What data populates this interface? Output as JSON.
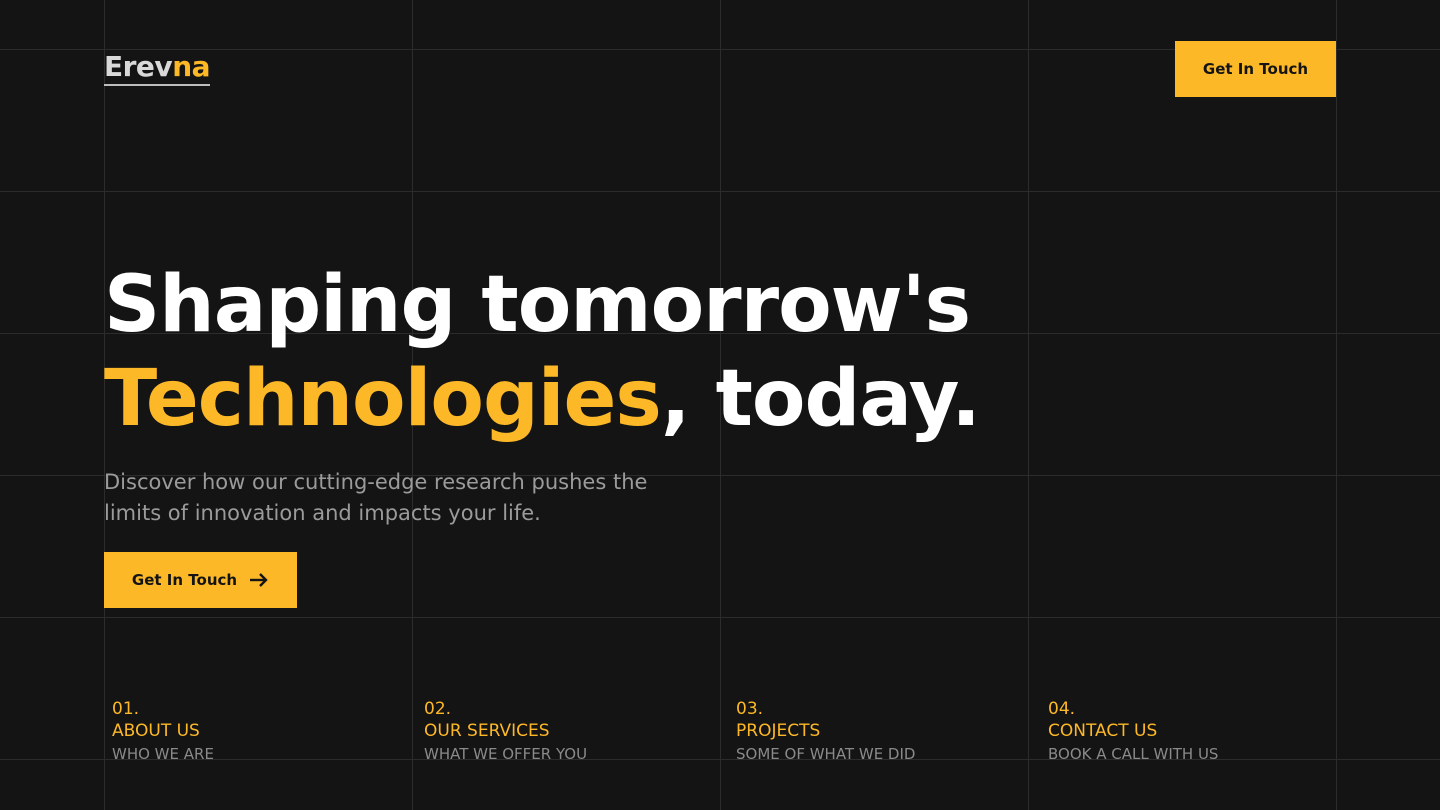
{
  "colors": {
    "background": "#141414",
    "accent": "#fdb827",
    "grid": "#2c2c2c",
    "muted": "#9b9b9b"
  },
  "logo": {
    "part1": "Erev",
    "part2": "na"
  },
  "header": {
    "cta_label": "Get In Touch"
  },
  "hero": {
    "line1": "Shaping tomorrow's",
    "accent_word": "Technologies",
    "line2_rest": ", today.",
    "subtitle": "Discover how our cutting-edge research pushes the limits of innovation and impacts your life.",
    "cta_label": "Get In Touch",
    "cta_icon": "arrow-right-icon"
  },
  "nav": [
    {
      "number": "01.",
      "title": "ABOUT US",
      "subtitle": "WHO WE ARE"
    },
    {
      "number": "02.",
      "title": "OUR SERVICES",
      "subtitle": "WHAT WE OFFER YOU"
    },
    {
      "number": "03.",
      "title": "PROJECTS",
      "subtitle": "SOME OF WHAT WE DID"
    },
    {
      "number": "04.",
      "title": "CONTACT US",
      "subtitle": "BOOK A CALL WITH US"
    }
  ]
}
